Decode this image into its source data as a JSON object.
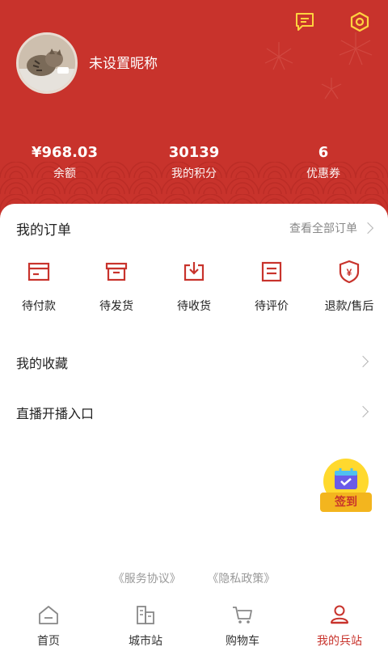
{
  "profile": {
    "nickname": "未设置昵称"
  },
  "stats": [
    {
      "value": "¥968.03",
      "label": "余额"
    },
    {
      "value": "30139",
      "label": "我的积分"
    },
    {
      "value": "6",
      "label": "优惠券"
    }
  ],
  "orders": {
    "title": "我的订单",
    "view_all": "查看全部订单",
    "items": [
      {
        "label": "待付款",
        "icon": "wallet-icon"
      },
      {
        "label": "待发货",
        "icon": "box-icon"
      },
      {
        "label": "待收货",
        "icon": "receive-icon"
      },
      {
        "label": "待评价",
        "icon": "review-icon"
      },
      {
        "label": "退款/售后",
        "icon": "refund-shield-icon"
      }
    ]
  },
  "menu": {
    "favorites": "我的收藏",
    "live": "直播开播入口"
  },
  "signin": {
    "label": "签到"
  },
  "footer": {
    "service": "《服务协议》",
    "privacy": "《隐私政策》"
  },
  "tabs": [
    {
      "label": "首页",
      "icon": "home-icon"
    },
    {
      "label": "城市站",
      "icon": "city-icon"
    },
    {
      "label": "购物车",
      "icon": "cart-icon"
    },
    {
      "label": "我的兵站",
      "icon": "profile-icon"
    }
  ],
  "colors": {
    "primary": "#c8332c",
    "signin_yellow": "#ffd92e",
    "signin_tag": "#f3b51e"
  }
}
